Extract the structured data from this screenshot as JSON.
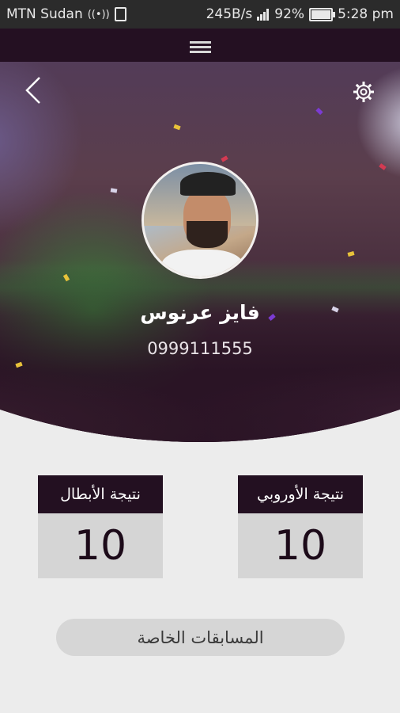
{
  "status_bar": {
    "carrier": "MTN Sudan",
    "speed": "245B/s",
    "battery": "92%",
    "time": "5:28 pm",
    "icons": [
      "wifi-hotspot-icon",
      "sim-icon",
      "signal-icon",
      "battery-icon"
    ]
  },
  "app_bar": {
    "menu_icon": "hamburger-icon"
  },
  "header": {
    "back_icon": "chevron-left-icon",
    "settings_icon": "gear-icon"
  },
  "profile": {
    "name": "فايز عرنوس",
    "phone": "0999111555"
  },
  "scores": {
    "champions_label": "نتيجة الأبطال",
    "champions_value": "10",
    "european_label": "نتيجة الأوروبي",
    "european_value": "10"
  },
  "special_competitions_label": "المسابقات الخاصة",
  "colors": {
    "app_bar": "#241022",
    "card_header": "#231021",
    "card_body": "#d5d5d5",
    "background": "#ececec"
  }
}
